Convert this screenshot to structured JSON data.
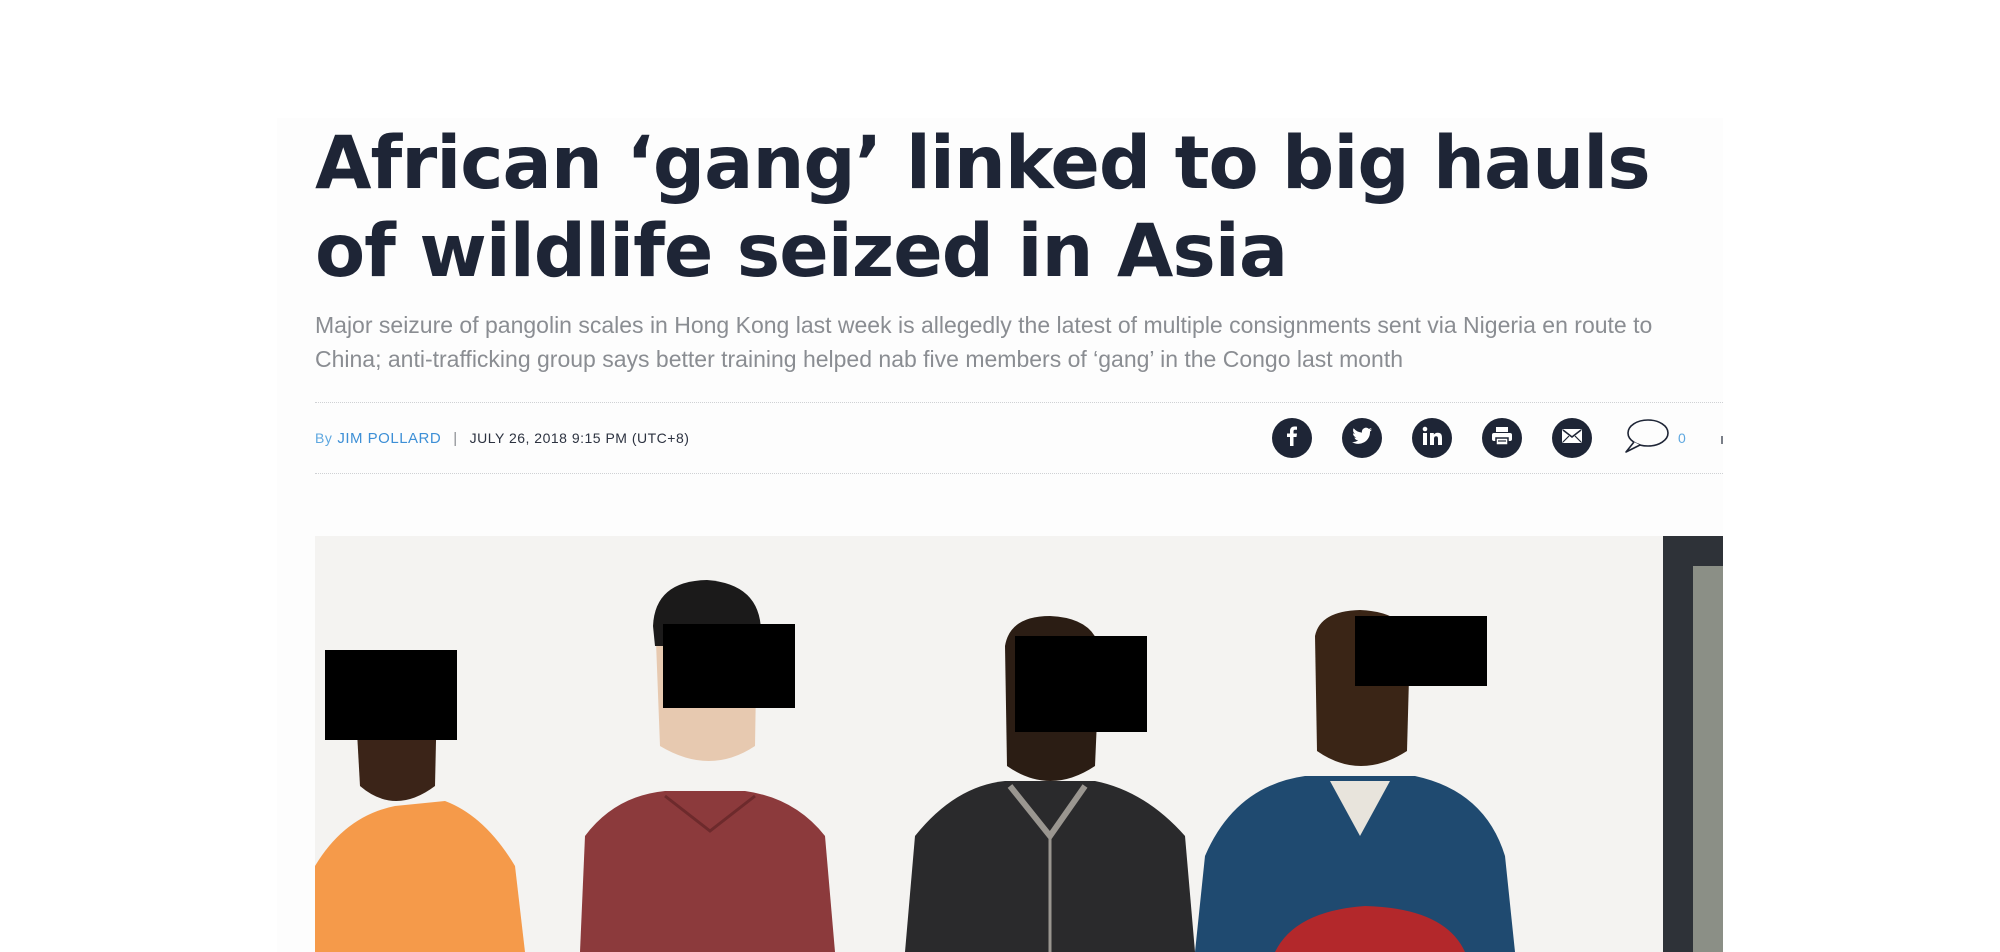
{
  "article": {
    "headline": "African ‘gang’ linked to big hauls of wildlife seized in Asia",
    "standfirst": "Major seizure of pangolin scales in Hong Kong last week is allegedly the latest of multiple consignments sent via Nigeria en route to China; anti-trafficking group says better training helped nab five members of ‘gang’ in the Congo last month",
    "byline": {
      "prefix": "By",
      "author": "JIM POLLARD",
      "separator": "|",
      "date": "JULY 26, 2018 9:15 PM (UTC+8)"
    },
    "share": {
      "icons": [
        "facebook-icon",
        "twitter-icon",
        "linkedin-icon",
        "print-icon",
        "email-icon",
        "comment-icon"
      ],
      "comment_count": "0"
    },
    "photo": {
      "subject": "four-men-faces-redacted",
      "colors": {
        "wall": "#f4f3f1",
        "orange_shirt": "#f59a4a",
        "maroon_shirt": "#8c3a3c",
        "jacket": "#2a2a2c",
        "blue_shirt": "#1f4a70",
        "redaction": "#000000"
      }
    }
  },
  "colors": {
    "headline": "#1e2536",
    "standfirst": "#8a8d92",
    "author_link": "#3d8fd6",
    "icon_fill": "#1e2536"
  }
}
